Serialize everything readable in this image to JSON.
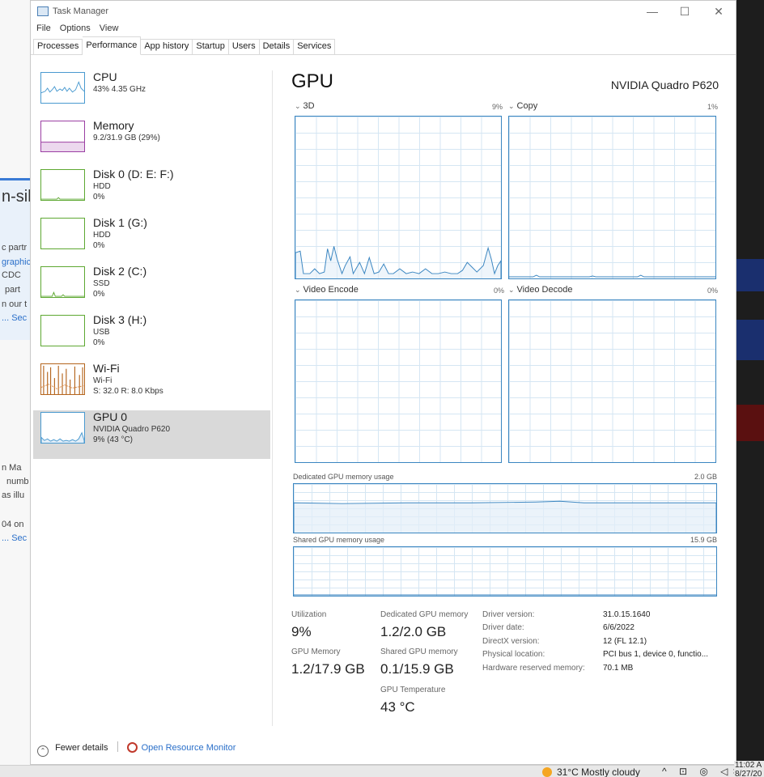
{
  "window": {
    "title": "Task Manager",
    "controls": {
      "minimize": "—",
      "maximize": "☐",
      "close": "✕"
    }
  },
  "menu": [
    "File",
    "Options",
    "View"
  ],
  "tabs": [
    "Processes",
    "Performance",
    "App history",
    "Startup",
    "Users",
    "Details",
    "Services"
  ],
  "active_tab": "Performance",
  "sidebar": {
    "items": [
      {
        "name": "CPU",
        "sub1": "43% 4.35 GHz",
        "sub2": "",
        "color": "#4a9ad0"
      },
      {
        "name": "Memory",
        "sub1": "9.2/31.9 GB (29%)",
        "sub2": "",
        "color": "#9b3fa3"
      },
      {
        "name": "Disk 0 (D: E: F:)",
        "sub1": "HDD",
        "sub2": "0%",
        "color": "#5ea832"
      },
      {
        "name": "Disk 1 (G:)",
        "sub1": "HDD",
        "sub2": "0%",
        "color": "#5ea832"
      },
      {
        "name": "Disk 2 (C:)",
        "sub1": "SSD",
        "sub2": "0%",
        "color": "#5ea832"
      },
      {
        "name": "Disk 3 (H:)",
        "sub1": "USB",
        "sub2": "0%",
        "color": "#5ea832"
      },
      {
        "name": "Wi-Fi",
        "sub1": "Wi-Fi",
        "sub2": "S: 32.0 R: 8.0 Kbps",
        "color": "#b5651d"
      },
      {
        "name": "GPU 0",
        "sub1": "NVIDIA Quadro P620",
        "sub2": "9% (43 °C)",
        "color": "#4a9ad0"
      }
    ]
  },
  "main": {
    "title": "GPU",
    "model": "NVIDIA Quadro P620",
    "engines": [
      {
        "label": "3D",
        "pct": "9%"
      },
      {
        "label": "Copy",
        "pct": "1%"
      },
      {
        "label": "Video Encode",
        "pct": "0%"
      },
      {
        "label": "Video Decode",
        "pct": "0%"
      }
    ],
    "dedicated_mem": {
      "label": "Dedicated GPU memory usage",
      "max": "2.0 GB"
    },
    "shared_mem": {
      "label": "Shared GPU memory usage",
      "max": "15.9 GB"
    },
    "stats": {
      "utilization": {
        "label": "Utilization",
        "value": "9%"
      },
      "dedicated": {
        "label": "Dedicated GPU memory",
        "value": "1.2/2.0 GB"
      },
      "gpu_memory": {
        "label": "GPU Memory",
        "value": "1.2/17.9 GB"
      },
      "shared": {
        "label": "Shared GPU memory",
        "value": "0.1/15.9 GB"
      },
      "temperature": {
        "label": "GPU Temperature",
        "value": "43 °C"
      }
    },
    "properties": [
      {
        "key": "Driver version:",
        "value": "31.0.15.1640"
      },
      {
        "key": "Driver date:",
        "value": "6/6/2022"
      },
      {
        "key": "DirectX version:",
        "value": "12 (FL 12.1)"
      },
      {
        "key": "Physical location:",
        "value": "PCI bus 1, device 0, functio..."
      },
      {
        "key": "Hardware reserved memory:",
        "value": "70.1 MB"
      }
    ]
  },
  "footer": {
    "fewer_details": "Fewer details",
    "resource_monitor": "Open Resource Monitor"
  },
  "taskbar": {
    "weather": "31°C  Mostly cloudy",
    "tray": "^ ⊡ ◎ ◁×",
    "time": "11:02 A",
    "date": "8/27/20"
  },
  "background": {
    "fragments": [
      "n-sili",
      "c partr",
      "graphic",
      "CDC",
      "part",
      "n our t",
      "... Sec",
      "n  Ma",
      "numb",
      "as illu",
      "04  on",
      "... Sec"
    ]
  }
}
